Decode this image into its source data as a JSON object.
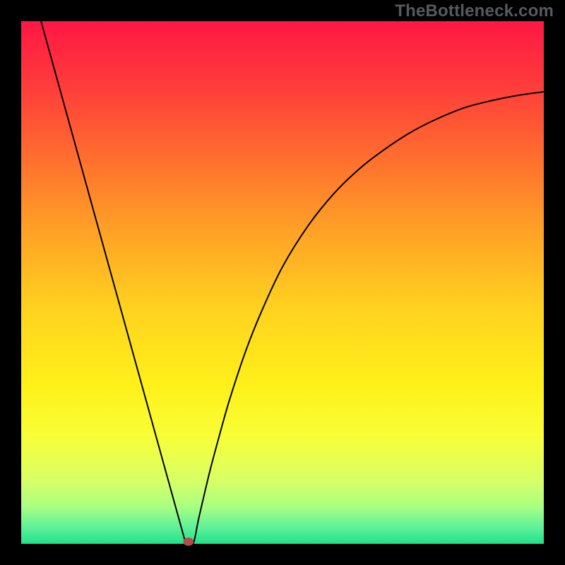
{
  "watermark": "TheBottleneck.com",
  "alt_text": "Bottleneck curve plot on a rainbow gradient background (red at top through orange, yellow, to green at bottom) with a black V-shaped curve: a straight left arm from the top-left corner descending to a sharp minimum near x≈0.31 at the bottom, and a concave right arm rising to the upper-right. A small dark-red marker sits at the minimum. The plot is framed by a thick black border.",
  "chart_data": {
    "type": "line",
    "title": "",
    "xlabel": "",
    "ylabel": "",
    "xlim": [
      0,
      1
    ],
    "ylim": [
      0,
      1
    ],
    "grid": false,
    "legend": false,
    "line_color": "#000000",
    "line_width": 2,
    "border": {
      "color": "#000000",
      "width": 30
    },
    "background_gradient": {
      "type": "linear-vertical",
      "stops": [
        {
          "pos": 0.0,
          "color": "#ff1744"
        },
        {
          "pos": 0.12,
          "color": "#ff3b3b"
        },
        {
          "pos": 0.25,
          "color": "#ff6a2f"
        },
        {
          "pos": 0.4,
          "color": "#ffa126"
        },
        {
          "pos": 0.55,
          "color": "#ffd21f"
        },
        {
          "pos": 0.7,
          "color": "#fff11a"
        },
        {
          "pos": 0.8,
          "color": "#f7ff3a"
        },
        {
          "pos": 0.88,
          "color": "#d6ff66"
        },
        {
          "pos": 0.93,
          "color": "#a8ff82"
        },
        {
          "pos": 0.97,
          "color": "#5cf09a"
        },
        {
          "pos": 1.0,
          "color": "#1fe28a"
        }
      ]
    },
    "series": [
      {
        "name": "left-arm",
        "x": [
          0.038,
          0.315
        ],
        "y": [
          1.0,
          0.0
        ]
      },
      {
        "name": "right-arm",
        "x": [
          0.315,
          0.329,
          0.34,
          0.36,
          0.38,
          0.4,
          0.43,
          0.46,
          0.5,
          0.55,
          0.6,
          0.65,
          0.7,
          0.75,
          0.8,
          0.85,
          0.9,
          0.95,
          1.0
        ],
        "y": [
          0.0,
          0.0,
          0.05,
          0.135,
          0.21,
          0.28,
          0.37,
          0.445,
          0.53,
          0.61,
          0.672,
          0.72,
          0.758,
          0.79,
          0.815,
          0.835,
          0.848,
          0.858,
          0.865
        ]
      }
    ],
    "marker": {
      "x": 0.32,
      "y": 0.004,
      "rx": 0.01,
      "ry": 0.008,
      "fill": "#b64a4a"
    }
  }
}
